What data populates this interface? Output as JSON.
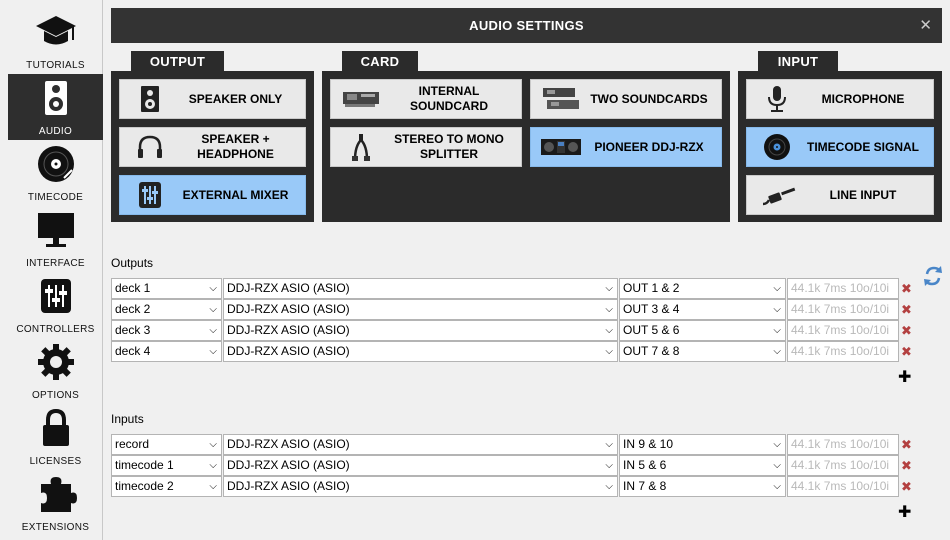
{
  "sidebar": {
    "items": [
      {
        "label": "TUTORIALS",
        "icon": "graduation-cap-icon"
      },
      {
        "label": "AUDIO",
        "icon": "speaker-icon",
        "active": true
      },
      {
        "label": "TIMECODE",
        "icon": "vinyl-record-icon"
      },
      {
        "label": "INTERFACE",
        "icon": "monitor-icon"
      },
      {
        "label": "CONTROLLERS",
        "icon": "sliders-icon"
      },
      {
        "label": "OPTIONS",
        "icon": "gear-icon"
      },
      {
        "label": "LICENSES",
        "icon": "lock-icon"
      },
      {
        "label": "EXTENSIONS",
        "icon": "puzzle-icon"
      }
    ]
  },
  "header": {
    "title": "AUDIO SETTINGS",
    "close": "✕"
  },
  "output": {
    "tab": "OUTPUT",
    "options": [
      {
        "label": "SPEAKER ONLY",
        "selected": false
      },
      {
        "label": "SPEAKER + HEADPHONE",
        "selected": false
      },
      {
        "label": "EXTERNAL MIXER",
        "selected": true
      }
    ]
  },
  "card": {
    "tab": "CARD",
    "options": [
      {
        "label": "INTERNAL SOUNDCARD",
        "selected": false
      },
      {
        "label": "TWO SOUNDCARDS",
        "selected": false
      },
      {
        "label": "STEREO TO MONO SPLITTER",
        "selected": false
      },
      {
        "label": "PIONEER DDJ-RZX",
        "selected": true
      }
    ]
  },
  "input": {
    "tab": "INPUT",
    "options": [
      {
        "label": "MICROPHONE",
        "selected": false
      },
      {
        "label": "TIMECODE SIGNAL",
        "selected": true
      },
      {
        "label": "LINE INPUT",
        "selected": false
      }
    ]
  },
  "outputs": {
    "label": "Outputs",
    "rows": [
      {
        "name": "deck 1",
        "device": "DDJ-RZX ASIO (ASIO)",
        "channels": "OUT 1 & 2",
        "info": "44.1k 7ms 10o/10i"
      },
      {
        "name": "deck 2",
        "device": "DDJ-RZX ASIO (ASIO)",
        "channels": "OUT 3 & 4",
        "info": "44.1k 7ms 10o/10i"
      },
      {
        "name": "deck 3",
        "device": "DDJ-RZX ASIO (ASIO)",
        "channels": "OUT 5 & 6",
        "info": "44.1k 7ms 10o/10i"
      },
      {
        "name": "deck 4",
        "device": "DDJ-RZX ASIO (ASIO)",
        "channels": "OUT 7 & 8",
        "info": "44.1k 7ms 10o/10i"
      }
    ]
  },
  "inputs": {
    "label": "Inputs",
    "rows": [
      {
        "name": "record",
        "device": "DDJ-RZX ASIO (ASIO)",
        "channels": "IN 9 & 10",
        "info": "44.1k 7ms 10o/10i"
      },
      {
        "name": "timecode 1",
        "device": "DDJ-RZX ASIO (ASIO)",
        "channels": "IN 5 & 6",
        "info": "44.1k 7ms 10o/10i"
      },
      {
        "name": "timecode 2",
        "device": "DDJ-RZX ASIO (ASIO)",
        "channels": "IN 7 & 8",
        "info": "44.1k 7ms 10o/10i"
      }
    ]
  },
  "symbols": {
    "dropdown": "⌵",
    "delete": "✖",
    "add": "✚"
  },
  "colors": {
    "selected": "#99c9f8",
    "panel": "#2b2b2b",
    "header": "#333333"
  }
}
